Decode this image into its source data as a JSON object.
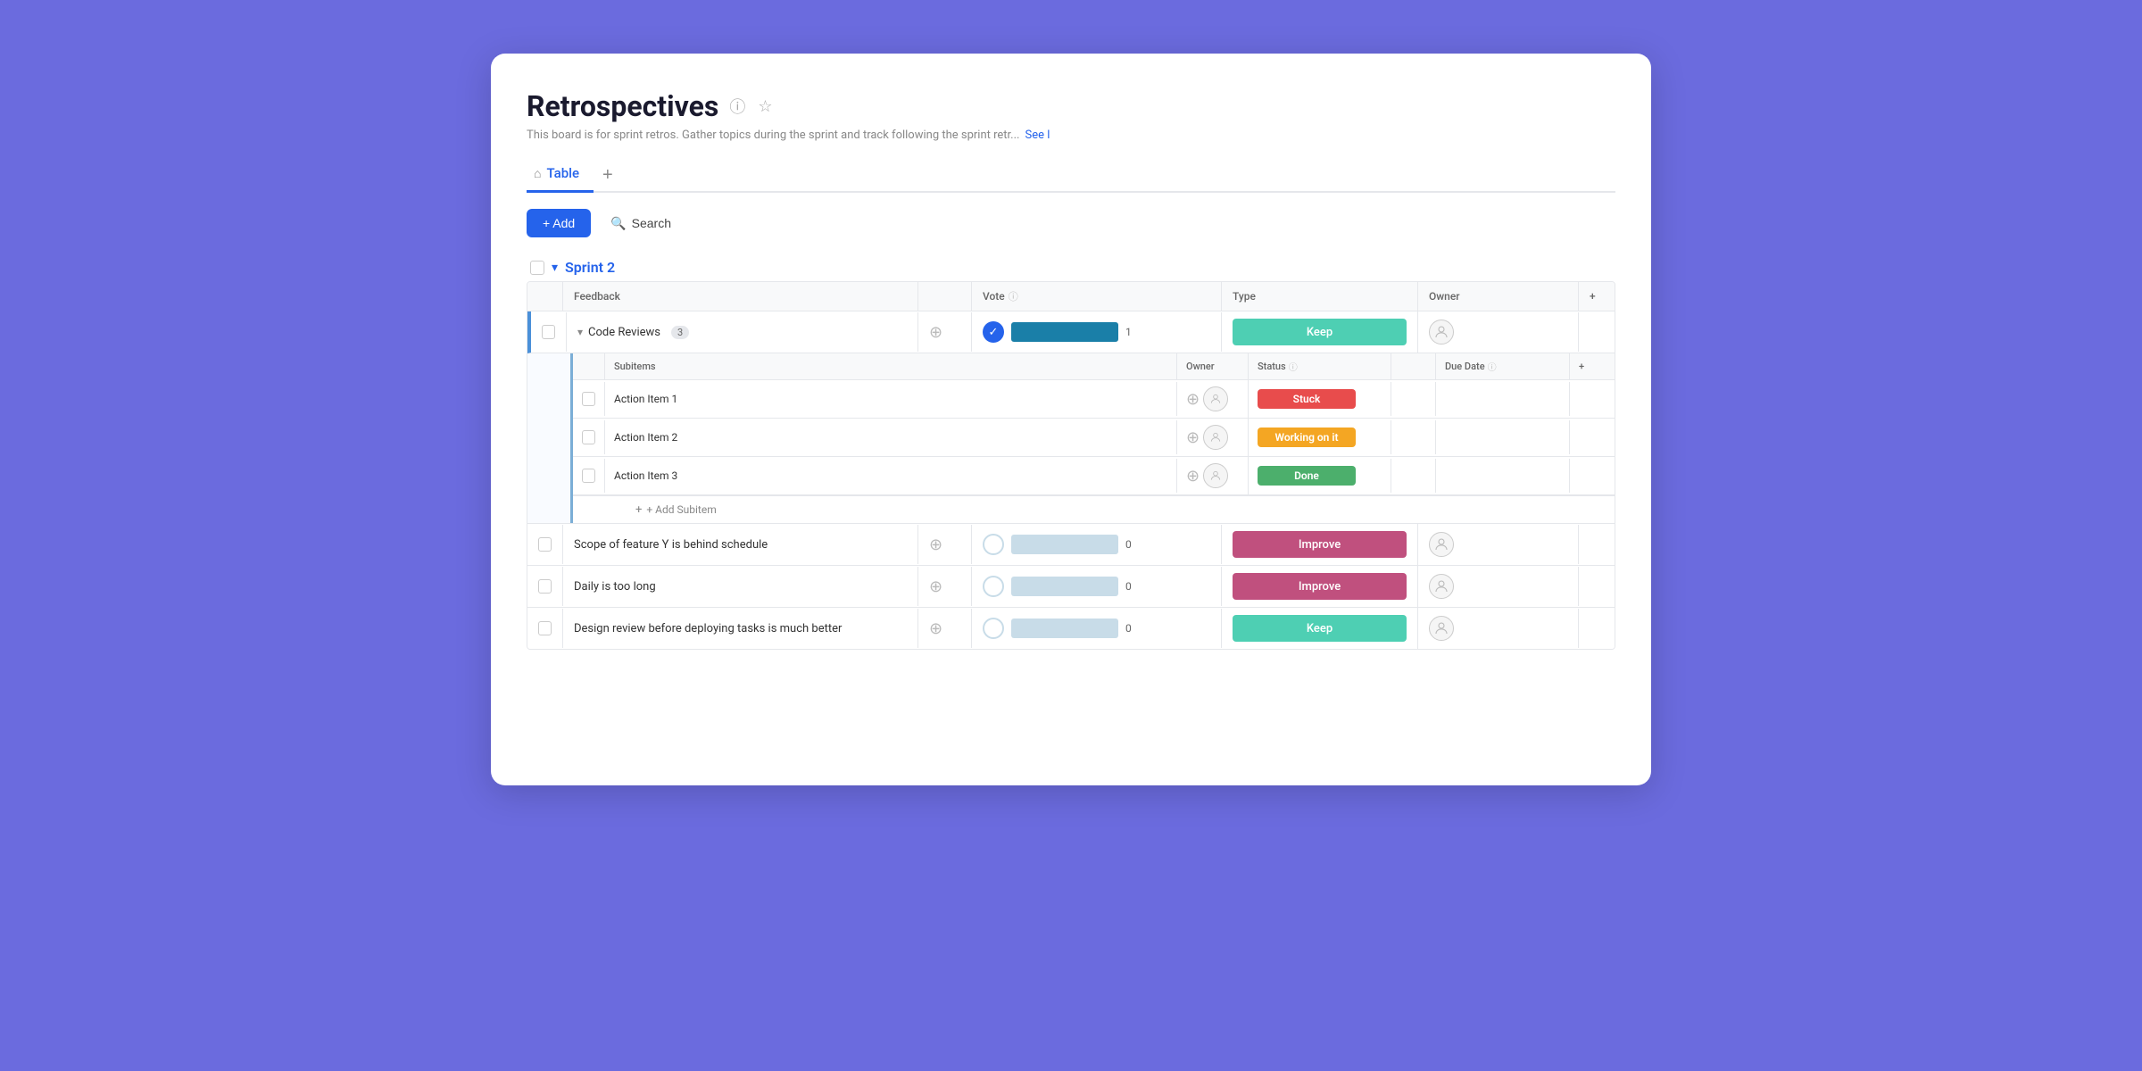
{
  "page": {
    "title": "Retrospectives",
    "description": "This board is for sprint retros. Gather topics during the sprint and track following the sprint retr...",
    "see_more": "See l",
    "tabs": [
      {
        "label": "Table",
        "active": true
      }
    ],
    "tab_add_label": "+",
    "toolbar": {
      "add_label": "+ Add",
      "search_label": "Search"
    }
  },
  "section": {
    "title": "Sprint 2"
  },
  "table": {
    "columns": [
      {
        "label": ""
      },
      {
        "label": "Feedback"
      },
      {
        "label": ""
      },
      {
        "label": "Vote"
      },
      {
        "label": "Type"
      },
      {
        "label": "Owner"
      },
      {
        "label": "+"
      }
    ],
    "rows": [
      {
        "id": "code-reviews",
        "label": "Code Reviews",
        "count": "3",
        "vote_value": 1,
        "vote_bar_filled": true,
        "type": "Keep",
        "type_class": "type-keep",
        "expanded": true
      },
      {
        "id": "scope-feature",
        "label": "Scope of feature Y is behind schedule",
        "vote_value": 0,
        "type": "Improve",
        "type_class": "type-improve"
      },
      {
        "id": "daily-long",
        "label": "Daily is too long",
        "vote_value": 0,
        "type": "Improve",
        "type_class": "type-improve"
      },
      {
        "id": "design-review",
        "label": "Design review before deploying tasks is much better",
        "vote_value": 0,
        "type": "Keep",
        "type_class": "type-keep"
      }
    ],
    "subitems": {
      "columns": [
        "",
        "Subitems",
        "Owner",
        "Status",
        "",
        "Due Date",
        "",
        "+"
      ],
      "rows": [
        {
          "label": "Action Item 1",
          "status": "Stuck",
          "status_class": "status-stuck"
        },
        {
          "label": "Action Item 2",
          "status": "Working on it",
          "status_class": "status-working"
        },
        {
          "label": "Action Item 3",
          "status": "Done",
          "status_class": "status-done"
        }
      ],
      "add_subitem_label": "+ Add Subitem"
    }
  },
  "icons": {
    "info": "ⓘ",
    "star": "☆",
    "home": "⌂",
    "chevron_down": "▾",
    "chevron_right": "›",
    "plus": "+",
    "search": "🔍",
    "check": "✓",
    "person": "👤",
    "add_circle": "⊕"
  }
}
